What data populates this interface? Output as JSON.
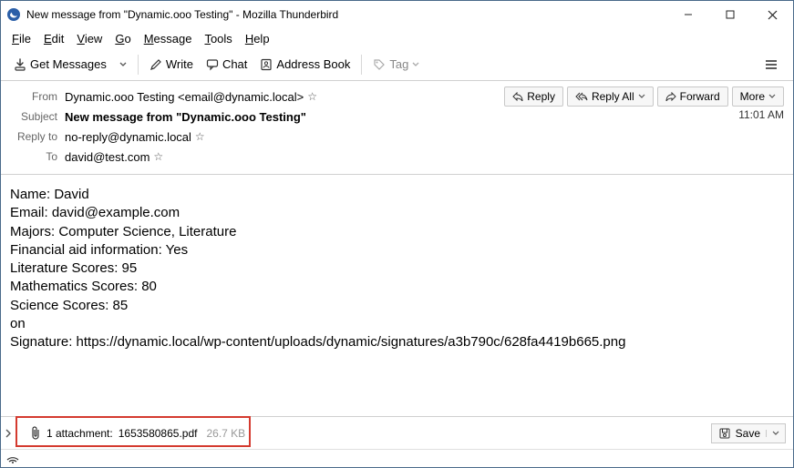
{
  "window": {
    "title": "New message from \"Dynamic.ooo Testing\" - Mozilla Thunderbird"
  },
  "menubar": {
    "file": "File",
    "edit": "Edit",
    "view": "View",
    "go": "Go",
    "message": "Message",
    "tools": "Tools",
    "help": "Help"
  },
  "toolbar": {
    "get_messages": "Get Messages",
    "write": "Write",
    "chat": "Chat",
    "address_book": "Address Book",
    "tag": "Tag"
  },
  "actions": {
    "reply": "Reply",
    "reply_all": "Reply All",
    "forward": "Forward",
    "more": "More"
  },
  "headers": {
    "from_label": "From",
    "from_value": "Dynamic.ooo Testing <email@dynamic.local>",
    "subject_label": "Subject",
    "subject_value": "New message from \"Dynamic.ooo Testing\"",
    "reply_to_label": "Reply to",
    "reply_to_value": "no-reply@dynamic.local",
    "to_label": "To",
    "to_value": "david@test.com",
    "time": "11:01 AM"
  },
  "body_lines": [
    "Name: David",
    "Email: david@example.com",
    "Majors: Computer Science, Literature",
    "Financial aid information: Yes",
    "Literature Scores: 95",
    "Mathematics Scores: 80",
    "Science Scores: 85",
    "on",
    "Signature: https://dynamic.local/wp-content/uploads/dynamic/signatures/a3b790c/628fa4419b665.png"
  ],
  "attachment": {
    "count_label": "1 attachment:",
    "filename": "1653580865.pdf",
    "size": "26.7 KB",
    "save": "Save"
  }
}
